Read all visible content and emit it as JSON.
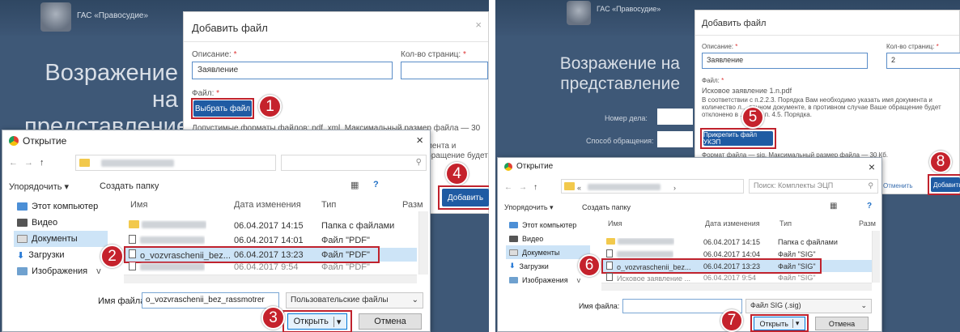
{
  "left": {
    "header": {
      "org": "ГАС «Правосудие»"
    },
    "page_title": "Возражение на представление",
    "add_dialog": {
      "title": "Добавить файл",
      "desc_label": "Описание:",
      "desc_value": "Заявление",
      "pages_label": "Кол-во страниц:",
      "file_label": "Файл:",
      "choose_button": "Выбрать файл",
      "formats_note": "Допустимые форматы файлов: pdf, xml. Максимальный размер файла — 30 Мб.",
      "side_note_1": "мента и",
      "side_note_2": "бращение будет",
      "add_button": "Добавить"
    },
    "open_dialog": {
      "title": "Открытие",
      "organize": "Упорядочить ▾",
      "new_folder": "Создать папку",
      "sidebar": [
        "Этот компьютер",
        "Видео",
        "Документы",
        "Загрузки",
        "Изображения"
      ],
      "columns": [
        "Имя",
        "Дата изменения",
        "Тип",
        "Разм"
      ],
      "rows": [
        {
          "name": "",
          "date": "06.04.2017 14:15",
          "type": "Папка с файлами"
        },
        {
          "name": "",
          "date": "06.04.2017 14:01",
          "type": "Файл \"PDF\""
        },
        {
          "name": "o_vozvraschenii_bez...",
          "date": "06.04.2017 13:23",
          "type": "Файл \"PDF\""
        },
        {
          "name": "",
          "date": "06.04.2017 9:54",
          "type": "Файл \"PDF\""
        }
      ],
      "filename_label": "Имя файла:",
      "filename_value": "o_vozvraschenii_bez_rassmotrer",
      "filetype": "Пользовательские файлы",
      "open_button": "Открыть",
      "cancel_button": "Отмена"
    },
    "badges": [
      "1",
      "2",
      "3",
      "4"
    ]
  },
  "right": {
    "header": {
      "org": "ГАС «Правосудие»"
    },
    "page_title": "Возражение на представление",
    "form_labels": [
      "Номер дела:",
      "Способ обращения:"
    ],
    "add_dialog": {
      "title": "Добавить файл",
      "desc_label": "Описание:",
      "desc_value": "Заявление",
      "pages_label": "Кол-во страниц:",
      "pages_value": "2",
      "file_label": "Файл:",
      "file_name": "Исковое заявление 1.n.pdf",
      "note": "В соответствии с п.2.2.3. Порядка Вам необходимо указать имя документа и количество л... данном документе, в противном случае Ваше обращение будет отклонено в ... вии с п. 4.5. Порядка.",
      "attach_button": "Прикрепить файл УКЭП",
      "sig_note": "Формат файла — sig. Максимальный размер файла — 30 Кб.",
      "cancel_link": "Отменить",
      "add_button": "Добавить"
    },
    "open_dialog": {
      "title": "Открытие",
      "address_tail": "›",
      "search_placeholder": "Поиск: Комплекты ЭЦП",
      "organize": "Упорядочить ▾",
      "new_folder": "Создать папку",
      "sidebar": [
        "Этот компьютер",
        "Видео",
        "Документы",
        "Загрузки",
        "Изображения"
      ],
      "columns": [
        "Имя",
        "Дата изменения",
        "Тип",
        "Разм"
      ],
      "rows": [
        {
          "name": "",
          "date": "06.04.2017 14:15",
          "type": "Папка с файлами"
        },
        {
          "name": "",
          "date": "06.04.2017 14:04",
          "type": "Файл \"SIG\""
        },
        {
          "name": "o_vozvraschenii_bez...",
          "date": "06.04.2017 13:23",
          "type": "Файл \"SIG\""
        },
        {
          "name": "Исковое заявление ...",
          "date": "06.04.2017 9:54",
          "type": "Файл \"SIG\""
        }
      ],
      "filename_label": "Имя файла:",
      "filename_value": "",
      "filetype": "Файл SIG (.sig)",
      "open_button": "Открыть",
      "cancel_button": "Отмена"
    },
    "badges": [
      "5",
      "6",
      "7",
      "8"
    ]
  }
}
